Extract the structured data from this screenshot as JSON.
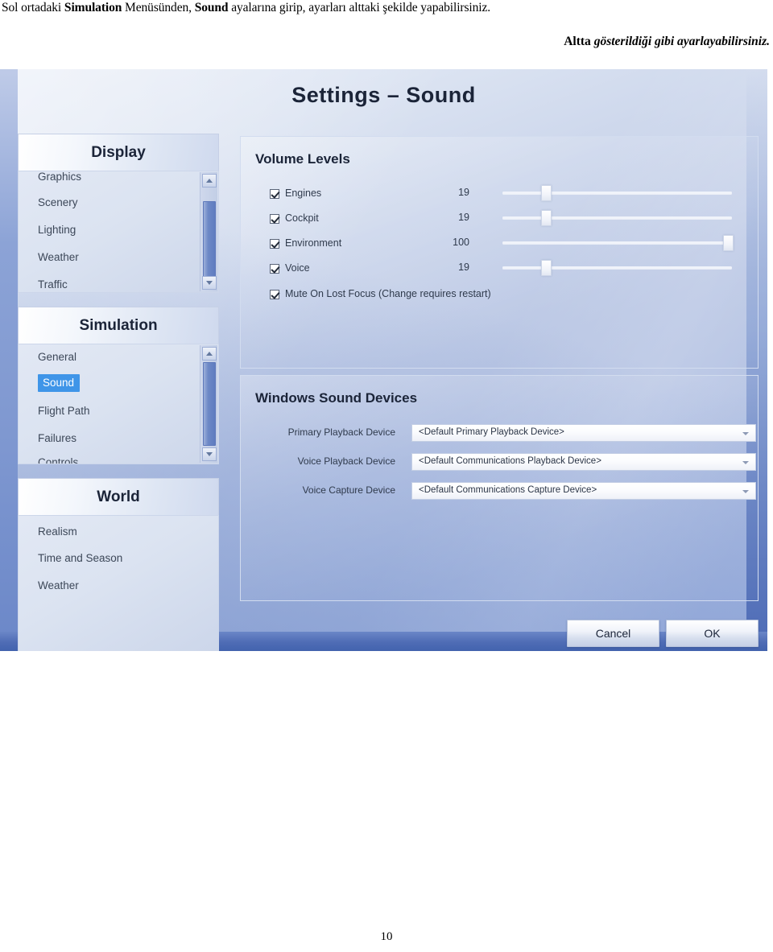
{
  "document": {
    "line1_prefix": "Sol ortadaki ",
    "line1_bold1": "Simulation",
    "line1_mid": " Menüsünden, ",
    "line1_bold2": "Sound",
    "line1_suffix": " ayalarına girip, ayarları alttaki şekilde yapabilirsiniz.",
    "line2_bold": "Altta ",
    "line2_italic": "gösterildiği gibi ayarlayabilirsiniz.",
    "page_number": "10"
  },
  "dialog": {
    "title": "Settings – Sound",
    "nav": [
      {
        "header": "Display",
        "items": [
          "Graphics",
          "Scenery",
          "Lighting",
          "Weather",
          "Traffic"
        ],
        "selected": null
      },
      {
        "header": "Simulation",
        "items": [
          "General",
          "Sound",
          "Flight Path",
          "Failures",
          "Controls"
        ],
        "selected": "Sound"
      },
      {
        "header": "World",
        "items": [
          "Realism",
          "Time and Season",
          "Weather"
        ],
        "selected": null
      }
    ],
    "volume_panel": {
      "title": "Volume Levels",
      "rows": [
        {
          "label": "Engines",
          "value": "19",
          "checked": true,
          "slider_pct": 19
        },
        {
          "label": "Cockpit",
          "value": "19",
          "checked": true,
          "slider_pct": 19
        },
        {
          "label": "Environment",
          "value": "100",
          "checked": true,
          "slider_pct": 100
        },
        {
          "label": "Voice",
          "value": "19",
          "checked": true,
          "slider_pct": 19
        }
      ],
      "mute": {
        "label": "Mute On Lost Focus (Change requires restart)",
        "checked": true
      }
    },
    "devices_panel": {
      "title": "Windows Sound Devices",
      "rows": [
        {
          "label": "Primary Playback Device",
          "value": "<Default Primary Playback Device>"
        },
        {
          "label": "Voice Playback Device",
          "value": "<Default Communications Playback Device>"
        },
        {
          "label": "Voice Capture Device",
          "value": "<Default Communications Capture Device>"
        }
      ]
    },
    "buttons": {
      "cancel": "Cancel",
      "ok": "OK"
    },
    "colors": {
      "selection": "#3f95e8",
      "title_text": "#1b2438",
      "dialog_bottom_band": "#4263ae"
    }
  }
}
